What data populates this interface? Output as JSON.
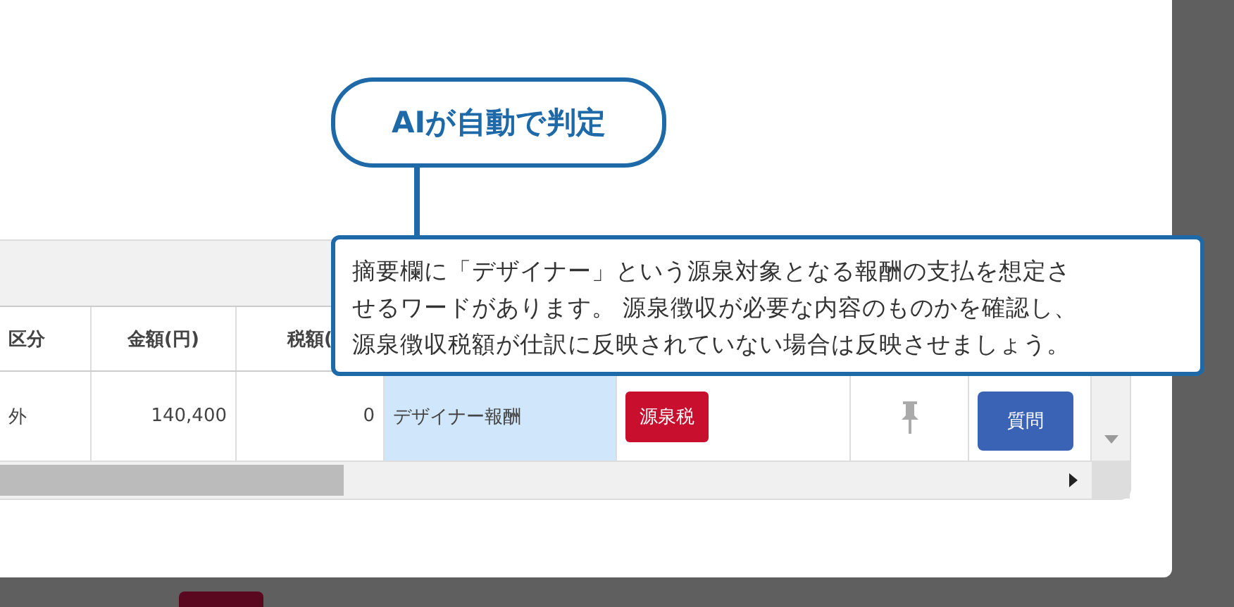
{
  "callout_label": "AIが自動で判定",
  "tooltip": {
    "lines": [
      "摘要欄に「デザイナー」という源泉対象となる報酬の支払を想定さ",
      "せるワードがあります。 源泉徴収が必要な内容のものかを確認し、",
      "源泉徴収税額が仕訳に反映されていない場合は反映させましょう。"
    ]
  },
  "table": {
    "columns": [
      "区分",
      "金額(円)",
      "税額("
    ],
    "rows": [
      {
        "category": "外",
        "amount": "140,400",
        "tax": "0",
        "description": "デザイナー報酬",
        "tag": "源泉税",
        "button": "質問"
      }
    ]
  }
}
